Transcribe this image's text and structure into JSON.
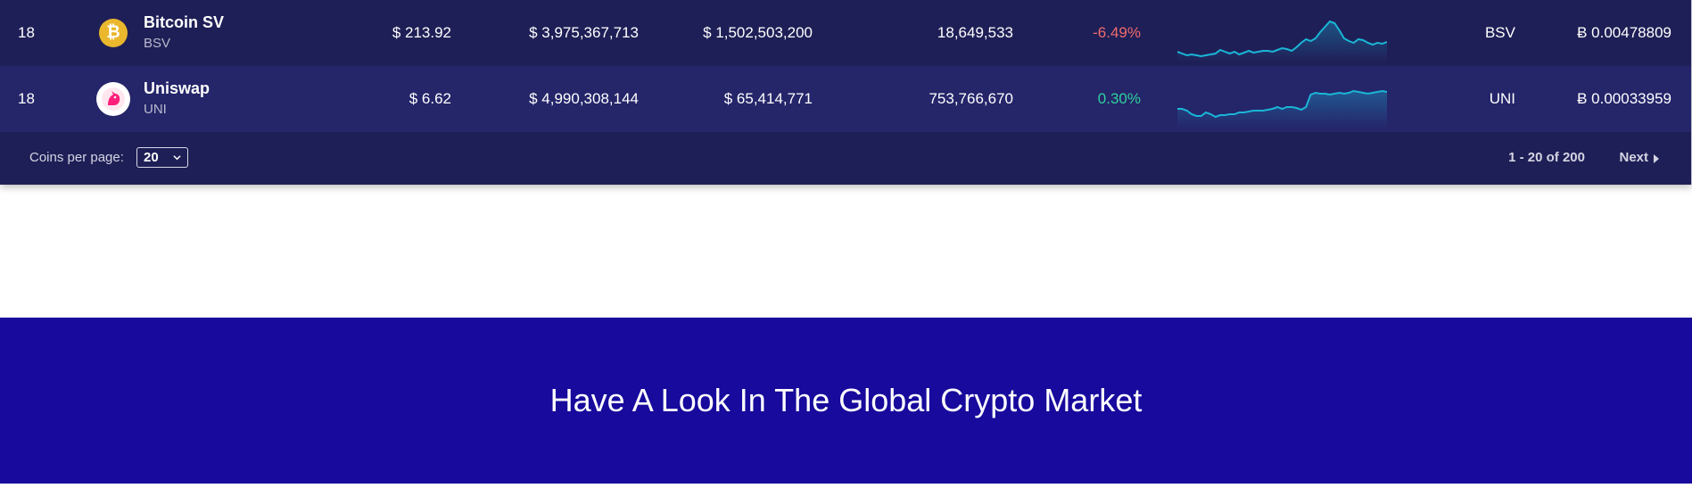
{
  "rows": [
    {
      "rank": "18",
      "icon": "bitcoin-sv-icon",
      "icon_glyph": "₿",
      "name": "Bitcoin SV",
      "symbol": "BSV",
      "price": "$ 213.92",
      "market_cap": "$ 3,975,367,713",
      "volume": "$ 1,502,503,200",
      "supply": "18,649,533",
      "change": "-6.49%",
      "change_direction": "negative",
      "spark": [
        48,
        50,
        52,
        51,
        52,
        53,
        52,
        51,
        50,
        46,
        48,
        50,
        48,
        51,
        49,
        47,
        49,
        48,
        47,
        47,
        48,
        46,
        44,
        45,
        47,
        43,
        38,
        34,
        36,
        33,
        26,
        20,
        14,
        16,
        24,
        33,
        36,
        38,
        34,
        35,
        38,
        40,
        38,
        39,
        37
      ],
      "symbol_col": "BSV",
      "btc_price": "Ƀ 0.00478809"
    },
    {
      "rank": "18",
      "icon": "uniswap-icon",
      "name": "Uniswap",
      "symbol": "UNI",
      "price": "$ 6.62",
      "market_cap": "$ 4,990,308,144",
      "volume": "$ 65,414,771",
      "supply": "753,766,670",
      "change": "0.30%",
      "change_direction": "positive",
      "spark": [
        38,
        38,
        40,
        44,
        46,
        46,
        42,
        44,
        47,
        45,
        45,
        44,
        44,
        42,
        42,
        41,
        40,
        40,
        40,
        39,
        38,
        36,
        38,
        36,
        36,
        37,
        39,
        36,
        22,
        20,
        21,
        21,
        22,
        21,
        20,
        21,
        20,
        18,
        19,
        20,
        21,
        20,
        19,
        18,
        19
      ],
      "symbol_col": "UNI",
      "btc_price": "Ƀ 0.00033959"
    }
  ],
  "footer": {
    "per_page_label": "Coins per page:",
    "per_page_value": "20",
    "paging": "1 - 20 of 200",
    "next_label": "Next"
  },
  "banner": {
    "title": "Have A Look In The Global Crypto Market"
  },
  "colors": {
    "table_bg": "#1f1f57",
    "row_alt_bg": "#25256a",
    "negative": "#ef6b6b",
    "positive": "#2fd19b",
    "sparkline": "#1ab6d6",
    "banner_bg": "#170a9c"
  }
}
